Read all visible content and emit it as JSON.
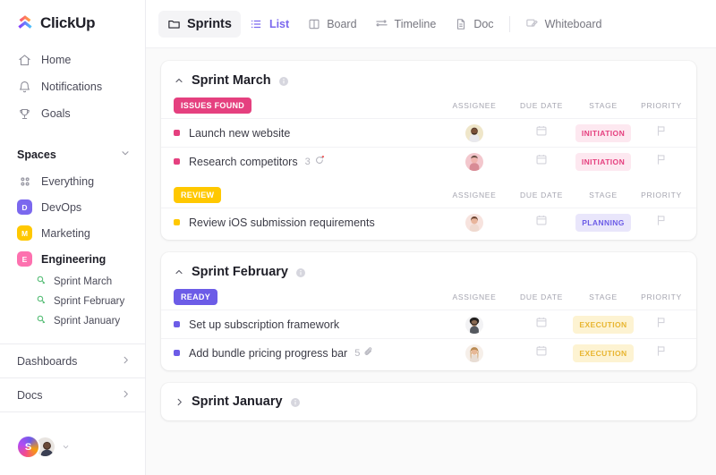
{
  "sidebar": {
    "logo": {
      "text": "ClickUp",
      "icon": "clickup-logo-icon"
    },
    "nav": [
      {
        "label": "Home",
        "icon": "home-icon"
      },
      {
        "label": "Notifications",
        "icon": "bell-icon"
      },
      {
        "label": "Goals",
        "icon": "trophy-icon"
      }
    ],
    "spaces_section": {
      "title": "Spaces",
      "chevron": "chevron-down-icon"
    },
    "spaces": [
      {
        "label": "Everything",
        "badge": "",
        "badge_color": "",
        "icon": "grid-dots-icon",
        "bold": false
      },
      {
        "label": "DevOps",
        "badge": "D",
        "badge_color": "#7b68ee",
        "bold": false
      },
      {
        "label": "Marketing",
        "badge": "M",
        "badge_color": "#ffc800",
        "bold": false
      },
      {
        "label": "Engineering",
        "badge": "E",
        "badge_color": "#fd71af",
        "bold": true
      }
    ],
    "sublists": [
      {
        "label": "Sprint  March",
        "icon": "rocket-icon"
      },
      {
        "label": "Sprint  February",
        "icon": "rocket-icon"
      },
      {
        "label": "Sprint January",
        "icon": "rocket-icon"
      }
    ],
    "bottom_sections": [
      {
        "label": "Dashboards",
        "chevron": "chevron-right-icon"
      },
      {
        "label": "Docs",
        "chevron": "chevron-right-icon"
      }
    ],
    "footer": {
      "avatar_initial": "S",
      "second_avatar": "user-photo-avatar",
      "caret": "caret-down-icon"
    }
  },
  "topbar": {
    "title": {
      "label": "Sprints",
      "icon": "folder-icon"
    },
    "tabs": [
      {
        "label": "List",
        "icon": "list-icon",
        "active": true
      },
      {
        "label": "Board",
        "icon": "board-icon",
        "active": false
      },
      {
        "label": "Timeline",
        "icon": "timeline-icon",
        "active": false
      },
      {
        "label": "Doc",
        "icon": "doc-icon",
        "active": false
      },
      {
        "label": "Whiteboard",
        "icon": "whiteboard-icon",
        "active": false
      }
    ]
  },
  "columns": [
    "ASSIGNEE",
    "DUE DATE",
    "STAGE",
    "PRIORITY"
  ],
  "sprints": [
    {
      "title": "Sprint March",
      "collapsed": false,
      "chevron": "chevron-up-icon",
      "groups": [
        {
          "status": "ISSUES FOUND",
          "status_bg": "#e5407f",
          "tasks": [
            {
              "name": "Launch new website",
              "dot_color": "#e5407f",
              "meta_count": "",
              "meta_icon": "",
              "avatar": "avatar-man-beard",
              "due_icon": "calendar-icon",
              "stage": "INITIATION",
              "stage_bg": "#fde8f0",
              "stage_color": "#e5407f",
              "priority_icon": "flag-icon"
            },
            {
              "name": "Research competitors",
              "dot_color": "#e5407f",
              "meta_count": "3",
              "meta_icon": "subtask-icon",
              "avatar": "avatar-person-pink",
              "due_icon": "calendar-icon",
              "stage": "INITIATION",
              "stage_bg": "#fde8f0",
              "stage_color": "#e5407f",
              "priority_icon": "flag-icon"
            }
          ]
        },
        {
          "status": "REVIEW",
          "status_bg": "#ffc800",
          "tasks": [
            {
              "name": "Review iOS submission requirements",
              "dot_color": "#ffc800",
              "meta_count": "",
              "meta_icon": "",
              "avatar": "avatar-woman-brown-hair",
              "due_icon": "calendar-icon",
              "stage": "PLANNING",
              "stage_bg": "#e9e6fb",
              "stage_color": "#6c5ce7",
              "priority_icon": "flag-icon"
            }
          ]
        }
      ]
    },
    {
      "title": "Sprint February",
      "collapsed": false,
      "chevron": "chevron-up-icon",
      "groups": [
        {
          "status": "READY",
          "status_bg": "#6c5ce7",
          "tasks": [
            {
              "name": "Set up subscription framework",
              "dot_color": "#6c5ce7",
              "meta_count": "",
              "meta_icon": "",
              "avatar": "avatar-person-afro",
              "due_icon": "calendar-icon",
              "stage": "EXECUTION",
              "stage_bg": "#fdf3d2",
              "stage_color": "#e8b530",
              "priority_icon": "flag-icon"
            },
            {
              "name": "Add bundle pricing progress bar",
              "dot_color": "#6c5ce7",
              "meta_count": "5",
              "meta_icon": "paperclip-icon",
              "avatar": "avatar-woman-blonde",
              "due_icon": "calendar-icon",
              "stage": "EXECUTION",
              "stage_bg": "#fdf3d2",
              "stage_color": "#e8b530",
              "priority_icon": "flag-icon"
            }
          ]
        }
      ]
    },
    {
      "title": "Sprint January",
      "collapsed": true,
      "chevron": "chevron-right-icon",
      "groups": []
    }
  ]
}
